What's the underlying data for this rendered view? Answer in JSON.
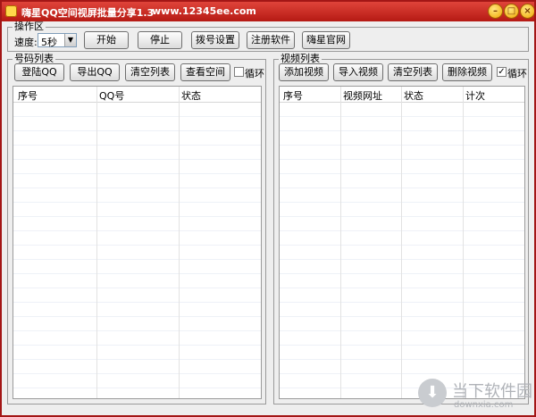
{
  "window": {
    "title": "嗨星QQ空间视屏批量分享1.3",
    "url": "www.12345ee.com",
    "minimize": "–",
    "maximize": "□",
    "close": "×"
  },
  "operation": {
    "group_title": "操作区",
    "speed_label": "速度:",
    "speed_value": "5秒",
    "start": "开始",
    "stop": "停止",
    "dial_settings": "拨号设置",
    "register": "注册软件",
    "official_site": "嗨星官网"
  },
  "number_list": {
    "group_title": "号码列表",
    "login_qq": "登陆QQ",
    "export_qq": "导出QQ",
    "clear_list": "清空列表",
    "view_space": "查看空间",
    "loop_label": "循环",
    "loop_checked": false,
    "columns": [
      "序号",
      "QQ号",
      "状态"
    ]
  },
  "video_list": {
    "group_title": "视频列表",
    "add_video": "添加视频",
    "import_video": "导入视频",
    "clear_list": "清空列表",
    "delete_video": "删除视频",
    "loop_label": "循环",
    "loop_checked": true,
    "columns": [
      "序号",
      "视频网址",
      "状态",
      "计次"
    ]
  },
  "watermark": {
    "text": "当下软件园",
    "sub": "downxia.com"
  }
}
